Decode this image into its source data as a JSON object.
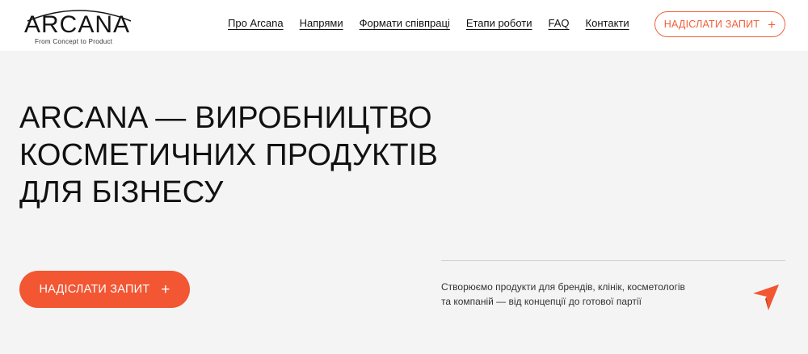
{
  "header": {
    "logo": {
      "word": "ARCANA",
      "tagline": "From Concept to Product"
    },
    "nav": [
      {
        "label": "Про Arcana"
      },
      {
        "label": "Напрями"
      },
      {
        "label": "Формати співпраці"
      },
      {
        "label": "Етапи роботи"
      },
      {
        "label": "FAQ"
      },
      {
        "label": "Контакти"
      }
    ],
    "cta": {
      "label": "НАДІСЛАТИ ЗАПИТ",
      "icon": "plus-icon"
    }
  },
  "hero": {
    "title_lines": [
      "ARCANA — ВИРОБНИЦТВО",
      "КОСМЕТИЧНИХ ПРОДУКТІВ",
      "ДЛЯ БІЗНЕСУ"
    ],
    "cta": {
      "label": "НАДІСЛАТИ ЗАПИТ",
      "icon": "plus-icon"
    },
    "description_lines": [
      "Створюємо продукти для брендів, клінік, косметологів",
      "та компаній — від концепції до готової партії"
    ],
    "decor_icon": "arrow-star-icon"
  },
  "colors": {
    "accent": "#f25632",
    "background": "#f4f4f4",
    "header_bg": "#ffffff",
    "text": "#111111"
  }
}
